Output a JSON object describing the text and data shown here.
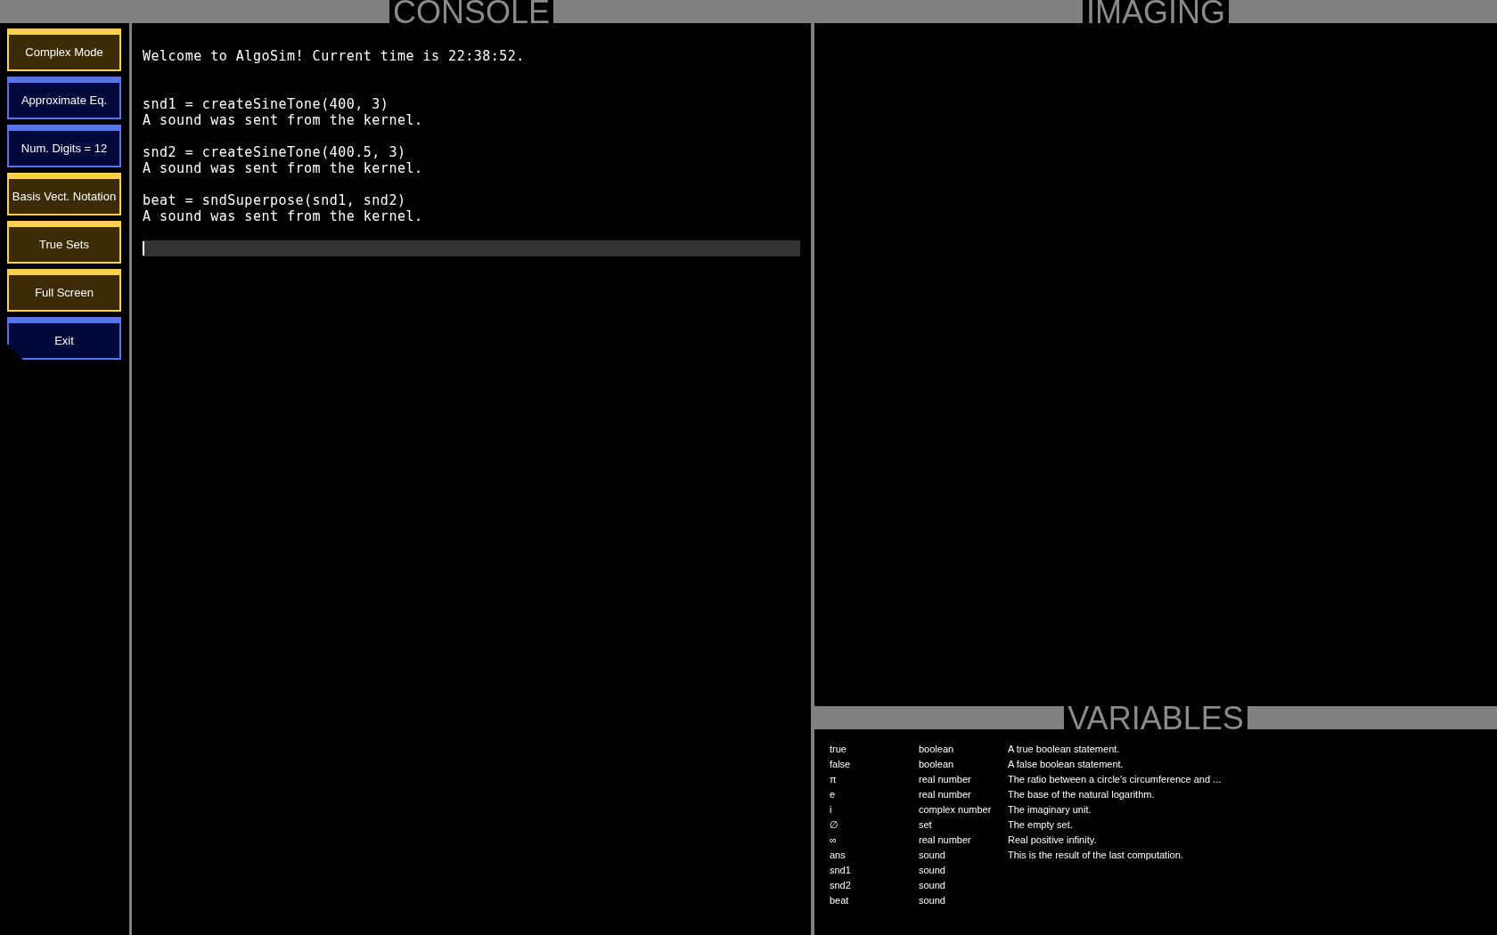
{
  "sidebar": {
    "buttons": [
      {
        "label": "Complex Mode",
        "kind": "toggle",
        "on": true
      },
      {
        "label": "Approximate Eq.",
        "kind": "toggle",
        "on": false
      },
      {
        "label": "Num. Digits = 12",
        "kind": "toggle",
        "on": false
      },
      {
        "label": "Basis Vect. Notation",
        "kind": "toggle",
        "on": true
      },
      {
        "label": "True Sets",
        "kind": "toggle",
        "on": true
      },
      {
        "label": "Full Screen",
        "kind": "toggle",
        "on": true
      },
      {
        "label": "Exit",
        "kind": "action",
        "on": false
      }
    ]
  },
  "console": {
    "title": "CONSOLE",
    "welcome": "Welcome to AlgoSim! Current time is 22:38:52.",
    "entries": [
      {
        "input": "snd1 = createSineTone(400, 3)",
        "output": "A sound was sent from the kernel."
      },
      {
        "input": "snd2 = createSineTone(400.5, 3)",
        "output": "A sound was sent from the kernel."
      },
      {
        "input": "beat = sndSuperpose(snd1, snd2)",
        "output": "A sound was sent from the kernel."
      }
    ]
  },
  "imaging": {
    "title": "IMAGING"
  },
  "variables": {
    "title": "VARIABLES",
    "rows": [
      {
        "name": "true",
        "type": "boolean",
        "description": "A true boolean statement."
      },
      {
        "name": "false",
        "type": "boolean",
        "description": "A false boolean statement."
      },
      {
        "name": "π",
        "type": "real number",
        "description": "The ratio between a circle's circumference and ..."
      },
      {
        "name": "e",
        "type": "real number",
        "description": "The base of the natural logarithm."
      },
      {
        "name": "i",
        "type": "complex number",
        "description": "The imaginary unit."
      },
      {
        "name": "∅",
        "type": "set",
        "description": "The empty set."
      },
      {
        "name": "∞",
        "type": "real number",
        "description": "Real positive infinity."
      },
      {
        "name": "ans",
        "type": "sound",
        "description": "This is the result of the last computation."
      },
      {
        "name": "snd1",
        "type": "sound"
      },
      {
        "name": "snd2",
        "type": "sound"
      },
      {
        "name": "beat",
        "type": "sound"
      }
    ]
  }
}
